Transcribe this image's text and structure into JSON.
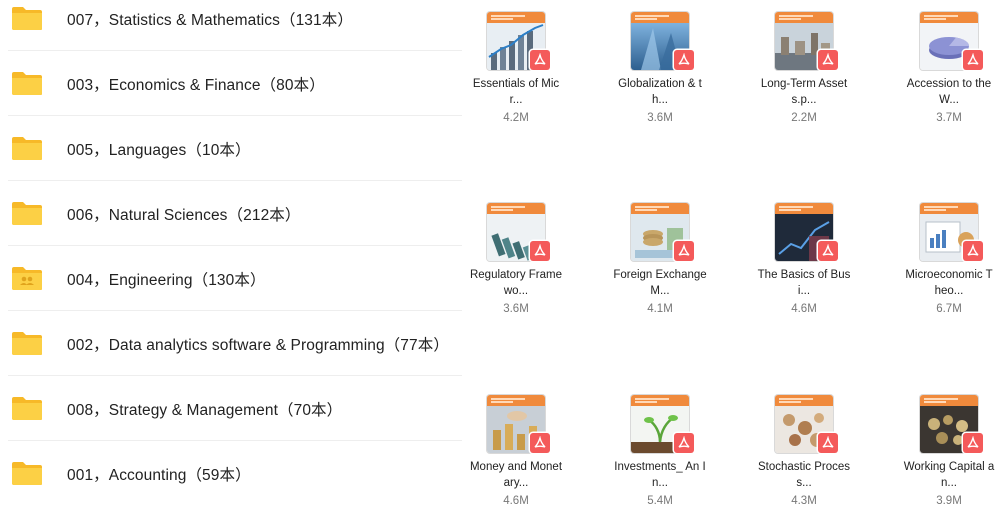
{
  "folders": [
    {
      "label": "007，Statistics & Mathematics（131本）",
      "icon": "folder-icon"
    },
    {
      "label": "003，Economics & Finance（80本）",
      "icon": "folder-icon"
    },
    {
      "label": "005，Languages（10本）",
      "icon": "folder-icon"
    },
    {
      "label": "006，Natural Sciences（212本）",
      "icon": "folder-icon"
    },
    {
      "label": "004，Engineering（130本）",
      "icon": "shared-folder-icon"
    },
    {
      "label": "002，Data analytics software & Programming（77本）",
      "icon": "folder-icon"
    },
    {
      "label": "008，Strategy & Management（70本）",
      "icon": "folder-icon"
    },
    {
      "label": "001，Accounting（59本）",
      "icon": "folder-icon"
    }
  ],
  "files": [
    {
      "name_line1": "Essentials of Mic",
      "name_line2": "r...",
      "size": "4.2M",
      "icon": "pdf-icon"
    },
    {
      "name_line1": "Globalization & t",
      "name_line2": "h...",
      "size": "3.6M",
      "icon": "pdf-icon"
    },
    {
      "name_line1": "Long-Term Asset",
      "name_line2": "s.p...",
      "size": "2.2M",
      "icon": "pdf-icon"
    },
    {
      "name_line1": "Accession to the",
      "name_line2": "W...",
      "size": "3.7M",
      "icon": "pdf-icon"
    },
    {
      "name_line1": "Regulatory Frame",
      "name_line2": "wo...",
      "size": "3.6M",
      "icon": "pdf-icon"
    },
    {
      "name_line1": "Foreign Exchange",
      "name_line2": "M...",
      "size": "4.1M",
      "icon": "pdf-icon"
    },
    {
      "name_line1": "The Basics of Bus",
      "name_line2": "i...",
      "size": "4.6M",
      "icon": "pdf-icon"
    },
    {
      "name_line1": "Microeconomic T",
      "name_line2": "heo...",
      "size": "6.7M",
      "icon": "pdf-icon"
    },
    {
      "name_line1": "Money and Monet",
      "name_line2": "ary...",
      "size": "4.6M",
      "icon": "pdf-icon"
    },
    {
      "name_line1": "Investments_ An I",
      "name_line2": "n...",
      "size": "5.4M",
      "icon": "pdf-icon"
    },
    {
      "name_line1": "Stochastic Proces",
      "name_line2": "s...",
      "size": "4.3M",
      "icon": "pdf-icon"
    },
    {
      "name_line1": "Working Capital a",
      "name_line2": "n...",
      "size": "3.9M",
      "icon": "pdf-icon"
    }
  ],
  "colors": {
    "folder": "#fbc531",
    "thumb_band": "#f08a3c",
    "pdf_badge": "#f45a5a"
  }
}
